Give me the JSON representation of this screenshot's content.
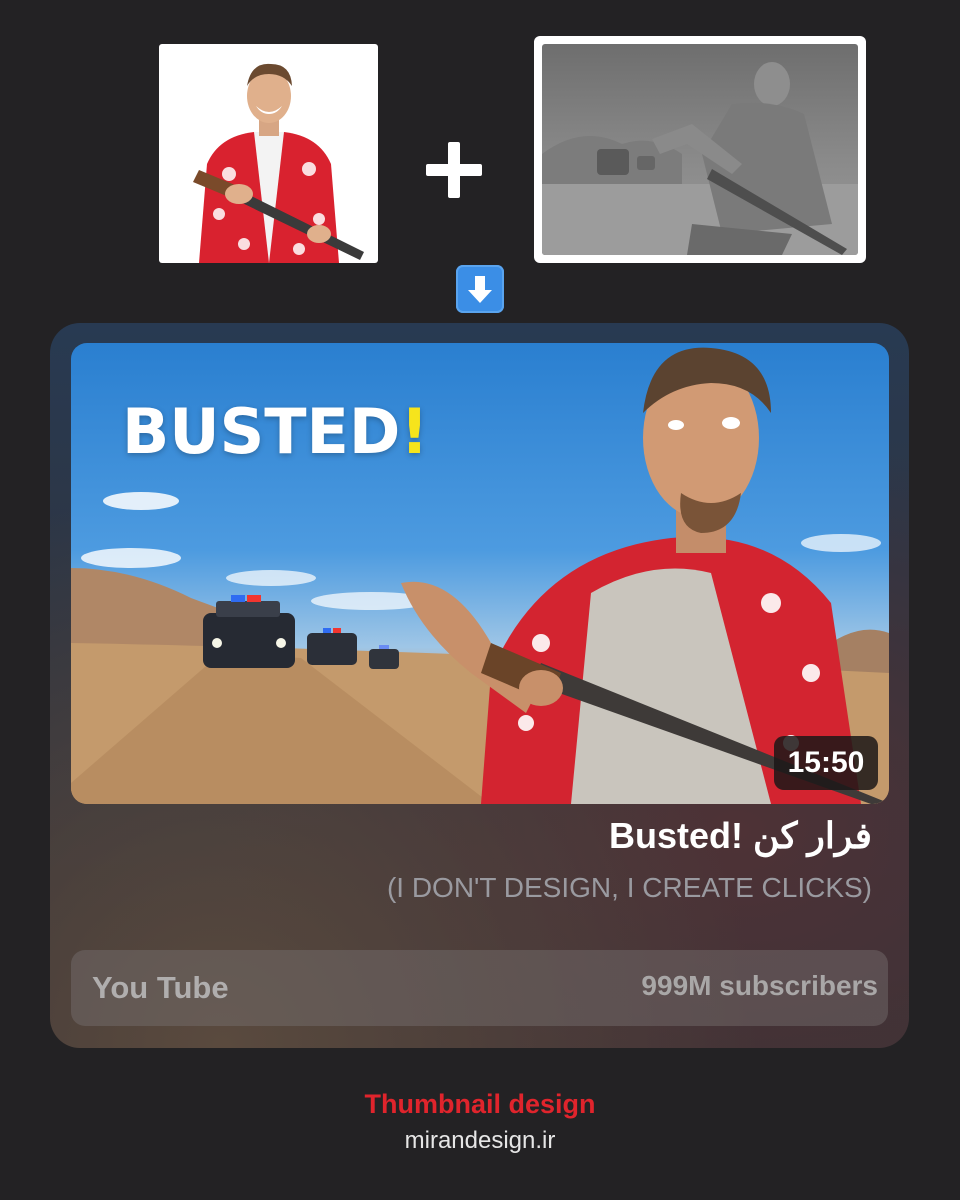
{
  "inputs": {
    "photo_alt": "person-in-hawaiian-shirt-with-shotgun",
    "sculpt_alt": "gray-3d-render-running-man"
  },
  "thumbnail": {
    "headline": "BUSTED",
    "headline_mark": "!",
    "duration": "15:50"
  },
  "video": {
    "title": "Busted! فرار کن",
    "subtitle": "(I DON'T DESIGN, I CREATE CLICKS)"
  },
  "channel": {
    "name": "You Tube",
    "subscribers": "999M subscribers"
  },
  "footer": {
    "title": "Thumbnail design",
    "site": "mirandesign.ir"
  },
  "colors": {
    "background": "#232224",
    "headline_mark": "#f6e41c",
    "footer_title": "#e0242c",
    "arrow_badge": "#3b8ee6"
  },
  "icons": [
    "plus-icon",
    "down-arrow-icon"
  ]
}
